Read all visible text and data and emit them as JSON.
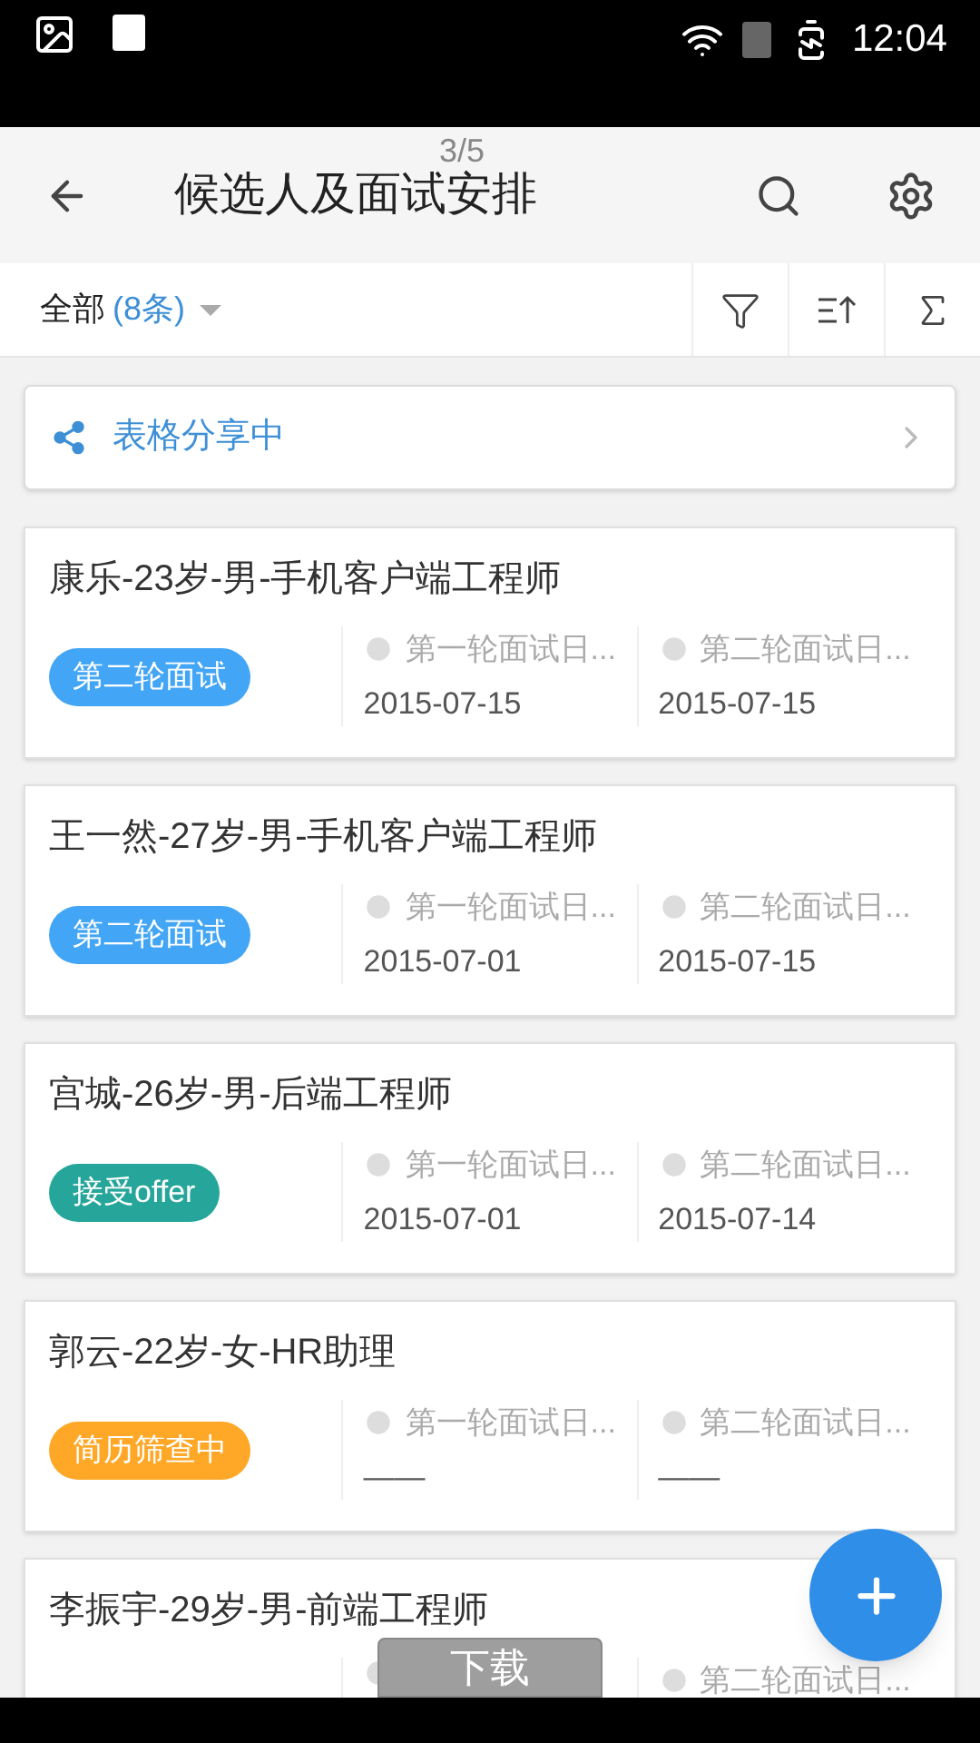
{
  "status_bar": {
    "time": "12:04"
  },
  "page_indicator": "3/5",
  "header": {
    "title": "候选人及面试安排"
  },
  "filter_bar": {
    "view": "全部",
    "count": "(8条)"
  },
  "share_banner": {
    "label": "表格分享中"
  },
  "candidates": [
    {
      "title": "康乐-23岁-男-手机客户端工程师",
      "status": {
        "label": "第二轮面试",
        "color": "#42a5f5"
      },
      "fields": [
        {
          "label": "第一轮面试日...",
          "value": "2015-07-15"
        },
        {
          "label": "第二轮面试日...",
          "value": "2015-07-15"
        }
      ]
    },
    {
      "title": "王一然-27岁-男-手机客户端工程师",
      "status": {
        "label": "第二轮面试",
        "color": "#42a5f5"
      },
      "fields": [
        {
          "label": "第一轮面试日...",
          "value": "2015-07-01"
        },
        {
          "label": "第二轮面试日...",
          "value": "2015-07-15"
        }
      ]
    },
    {
      "title": "宫城-26岁-男-后端工程师",
      "status": {
        "label": "接受offer",
        "color": "#26a69a"
      },
      "fields": [
        {
          "label": "第一轮面试日...",
          "value": "2015-07-01"
        },
        {
          "label": "第二轮面试日...",
          "value": "2015-07-14"
        }
      ]
    },
    {
      "title": "郭云-22岁-女-HR助理",
      "status": {
        "label": "简历筛查中",
        "color": "#ffa726"
      },
      "fields": [
        {
          "label": "第一轮面试日...",
          "value": "——"
        },
        {
          "label": "第二轮面试日...",
          "value": "——"
        }
      ]
    },
    {
      "title": "李振宇-29岁-男-前端工程师",
      "fields": [
        {
          "kind": "covered"
        },
        {
          "kind": "date",
          "label": "第二轮面试日..."
        }
      ]
    }
  ],
  "toast": {
    "label": "下载"
  }
}
